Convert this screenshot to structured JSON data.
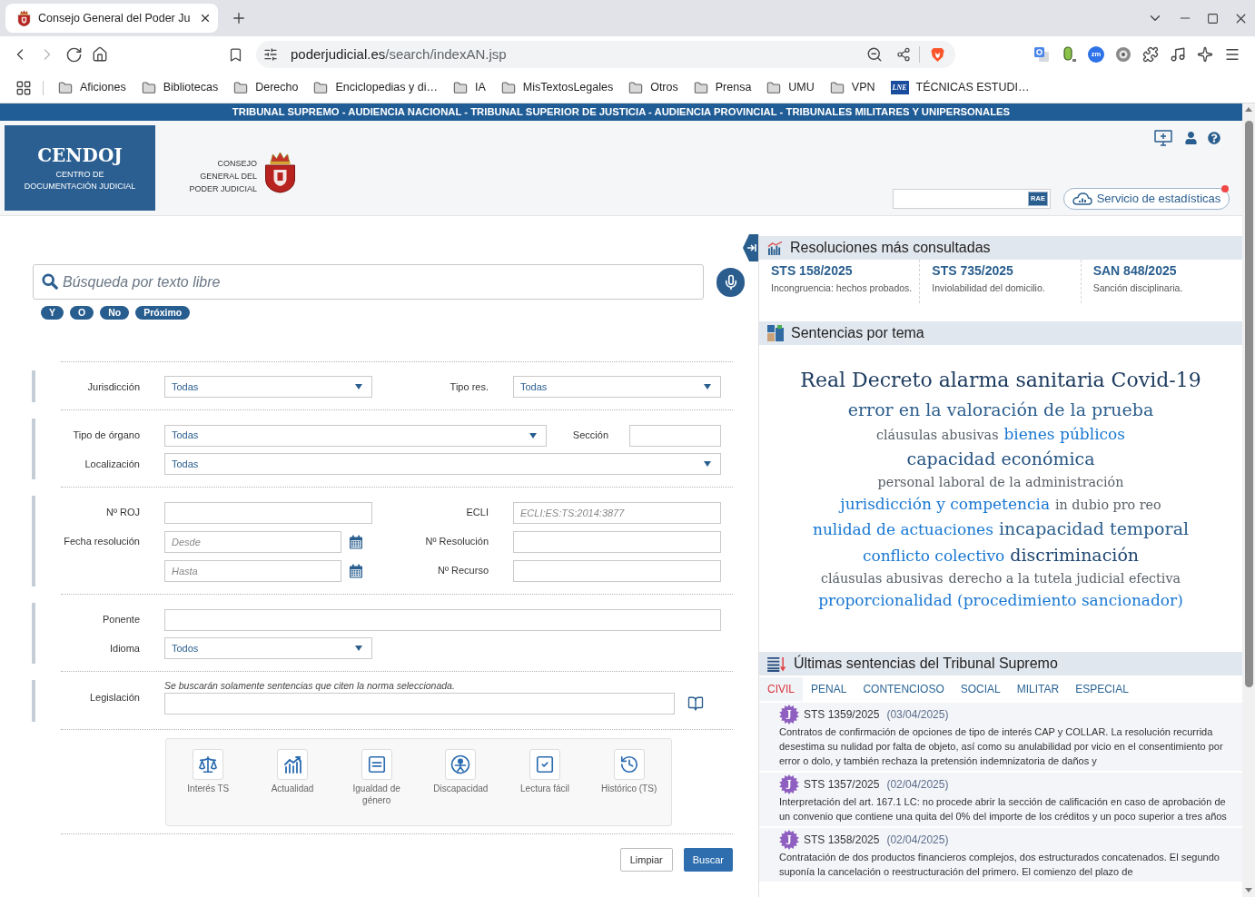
{
  "browser": {
    "tab_title": "Consejo General del Poder Ju",
    "url_host": "poderjudicial.es",
    "url_path": "/search/indexAN.jsp",
    "extension_label": "zm",
    "bookmarks": [
      {
        "label": "Aficiones",
        "kind": "folder"
      },
      {
        "label": "Bibliotecas",
        "kind": "folder"
      },
      {
        "label": "Derecho",
        "kind": "folder"
      },
      {
        "label": "Enciclopedias y di…",
        "kind": "folder"
      },
      {
        "label": "IA",
        "kind": "folder"
      },
      {
        "label": "MisTextosLegales",
        "kind": "folder"
      },
      {
        "label": "Otros",
        "kind": "folder"
      },
      {
        "label": "Prensa",
        "kind": "folder"
      },
      {
        "label": "UMU",
        "kind": "folder"
      },
      {
        "label": "VPN",
        "kind": "folder"
      },
      {
        "label": "TÉCNICAS ESTUDI…",
        "kind": "site",
        "logo": "LNE"
      }
    ]
  },
  "banner": "TRIBUNAL SUPREMO - AUDIENCIA NACIONAL - TRIBUNAL SUPERIOR DE JUSTICIA - AUDIENCIA PROVINCIAL - TRIBUNALES MILITARES Y UNIPERSONALES",
  "header": {
    "logo": {
      "title": "CENDOJ",
      "subtitle_lines": [
        "CENTRO DE",
        "DOCUMENTACIÓN JUDICIAL"
      ]
    },
    "council_lines": [
      "CONSEJO",
      "GENERAL DEL",
      "PODER JUDICIAL"
    ],
    "dictionary_search": {
      "label": "RAE"
    },
    "stats_button": {
      "label": "Servicio de estadísticas",
      "notification": true
    }
  },
  "search": {
    "placeholder": "Búsqueda por texto libre",
    "operators": [
      "Y",
      "O",
      "No",
      "Próximo"
    ]
  },
  "form": {
    "groups": [
      {
        "rows": [
          {
            "kind": "pair",
            "fields": [
              {
                "label": "Jurisdicción",
                "kind": "select",
                "value": "Todas"
              },
              {
                "label": "Tipo res.",
                "kind": "select",
                "value": "Todas"
              }
            ]
          }
        ]
      },
      {
        "rows": [
          {
            "kind": "wide_pair",
            "fields": [
              {
                "label": "Tipo de órgano",
                "kind": "select",
                "value": "Todas"
              },
              {
                "label": "Sección",
                "kind": "text"
              }
            ]
          },
          {
            "kind": "full",
            "fields": [
              {
                "label": "Localización",
                "kind": "select",
                "value": "Todas"
              }
            ]
          }
        ]
      },
      {
        "rows": [
          {
            "kind": "pair",
            "fields": [
              {
                "label": "Nº ROJ",
                "kind": "text"
              },
              {
                "label": "ECLI",
                "kind": "text",
                "placeholder": "ECLI:ES:TS:2014:3877"
              }
            ]
          },
          {
            "kind": "pair",
            "fields": [
              {
                "label": "Fecha resolución",
                "kind": "date",
                "placeholder": "Desde"
              },
              {
                "label": "Nº Resolución",
                "kind": "text"
              }
            ]
          },
          {
            "kind": "pair",
            "fields": [
              {
                "kind": "date",
                "placeholder": "Hasta"
              },
              {
                "label": "Nº Recurso",
                "kind": "text"
              }
            ]
          }
        ]
      },
      {
        "rows": [
          {
            "kind": "full",
            "fields": [
              {
                "label": "Ponente",
                "kind": "text"
              }
            ]
          },
          {
            "kind": "half",
            "fields": [
              {
                "label": "Idioma",
                "kind": "select",
                "value": "Todos"
              }
            ]
          }
        ]
      },
      {
        "rows": [
          {
            "kind": "lookup",
            "fields": [
              {
                "label": "Legislación",
                "kind": "lookup",
                "note": "Se buscarán solamente sentencias que citen la norma seleccionada."
              }
            ]
          }
        ]
      }
    ]
  },
  "tools": [
    {
      "label": "Interés TS",
      "kind": "interest"
    },
    {
      "label": "Actualidad",
      "kind": "news"
    },
    {
      "label": "Igualdad de género",
      "kind": "equality"
    },
    {
      "label": "Discapacidad",
      "kind": "disability"
    },
    {
      "label": "Lectura fácil",
      "kind": "easy_read"
    },
    {
      "label": "Histórico (TS)",
      "kind": "history"
    }
  ],
  "actions": [
    {
      "label": "Limpiar",
      "kind": "secondary"
    },
    {
      "label": "Buscar",
      "kind": "primary"
    }
  ],
  "most_consulted": {
    "title": "Resoluciones más consultadas",
    "items": [
      {
        "ref": "STS 158/2025",
        "summary": "Incongruencia: hechos probados."
      },
      {
        "ref": "STS 735/2025",
        "summary": "Inviolabilidad del domicilio."
      },
      {
        "ref": "SAN 848/2025",
        "summary": "Sanción disciplinaria."
      }
    ]
  },
  "topics": {
    "title": "Sentencias por tema",
    "lines": [
      {
        "words": [
          {
            "text": "Real Decreto alarma sanitaria Covid-19",
            "kind": "xl",
            "color": "#1c3a5e"
          }
        ]
      },
      {
        "words": [
          {
            "text": "error en la valoración de la prueba",
            "kind": "lg",
            "color": "#2b5d8c"
          }
        ]
      },
      {
        "words": [
          {
            "text": "cláusulas abusivas",
            "kind": "sm",
            "color": "#585f66"
          },
          {
            "text": "bienes públicos",
            "kind": "md",
            "color": "#1877d2"
          }
        ]
      },
      {
        "words": [
          {
            "text": "capacidad económica",
            "kind": "lg",
            "color": "#245280"
          }
        ]
      },
      {
        "words": [
          {
            "text": "personal laboral de la administración",
            "kind": "sm",
            "color": "#585f66"
          }
        ]
      },
      {
        "words": [
          {
            "text": "jurisdicción y competencia",
            "kind": "md",
            "color": "#1877d2"
          },
          {
            "text": "in dubio pro reo",
            "kind": "sm",
            "color": "#585f66"
          }
        ]
      },
      {
        "words": [
          {
            "text": "nulidad de actuaciones",
            "kind": "md",
            "color": "#1877d2"
          },
          {
            "text": "incapacidad temporal",
            "kind": "lg",
            "color": "#2b5d8c"
          }
        ]
      },
      {
        "words": [
          {
            "text": "conflicto colectivo",
            "kind": "md",
            "color": "#1877d2"
          },
          {
            "text": "discriminación",
            "kind": "lg",
            "color": "#1f4670"
          }
        ]
      },
      {
        "words": [
          {
            "text": "cláusulas abusivas",
            "kind": "sm",
            "color": "#585f66"
          },
          {
            "text": "derecho a la tutela judicial efectiva",
            "kind": "sm",
            "color": "#585f66"
          }
        ]
      },
      {
        "words": [
          {
            "text": "proporcionalidad (procedimiento sancionador)",
            "kind": "md",
            "color": "#1877d2"
          }
        ]
      }
    ]
  },
  "latest": {
    "title": "Últimas sentencias del Tribunal Supremo",
    "tabs": [
      {
        "label": "CIVIL",
        "selected": true
      },
      {
        "label": "PENAL",
        "selected": false
      },
      {
        "label": "CONTENCIOSO",
        "selected": false
      },
      {
        "label": "SOCIAL",
        "selected": false
      },
      {
        "label": "MILITAR",
        "selected": false
      },
      {
        "label": "ESPECIAL",
        "selected": false
      }
    ],
    "items": [
      {
        "badge": "J",
        "ref": "STS 1359/2025",
        "date": "(03/04/2025)",
        "summary": "Contratos de confirmación de opciones de tipo de interés CAP y COLLAR. La resolución recurrida desestima su nulidad por falta de objeto, así como su anulabilidad por vicio en el consentimiento por error o dolo, y también rechaza la pretensión indemnizatoria de daños y"
      },
      {
        "badge": "J",
        "ref": "STS 1357/2025",
        "date": "(02/04/2025)",
        "summary": "Interpretación del art. 167.1 LC: no procede abrir la sección de calificación en caso de aprobación de un convenio que contiene una quita del 0% del importe de los créditos y un poco superior a tres años"
      },
      {
        "badge": "J",
        "ref": "STS 1358/2025",
        "date": "(02/04/2025)",
        "summary": "Contratación de dos productos financieros complejos, dos estructurados concatenados. El segundo suponía la cancelación o reestructuración del primero. El comienzo del plazo de"
      }
    ]
  }
}
